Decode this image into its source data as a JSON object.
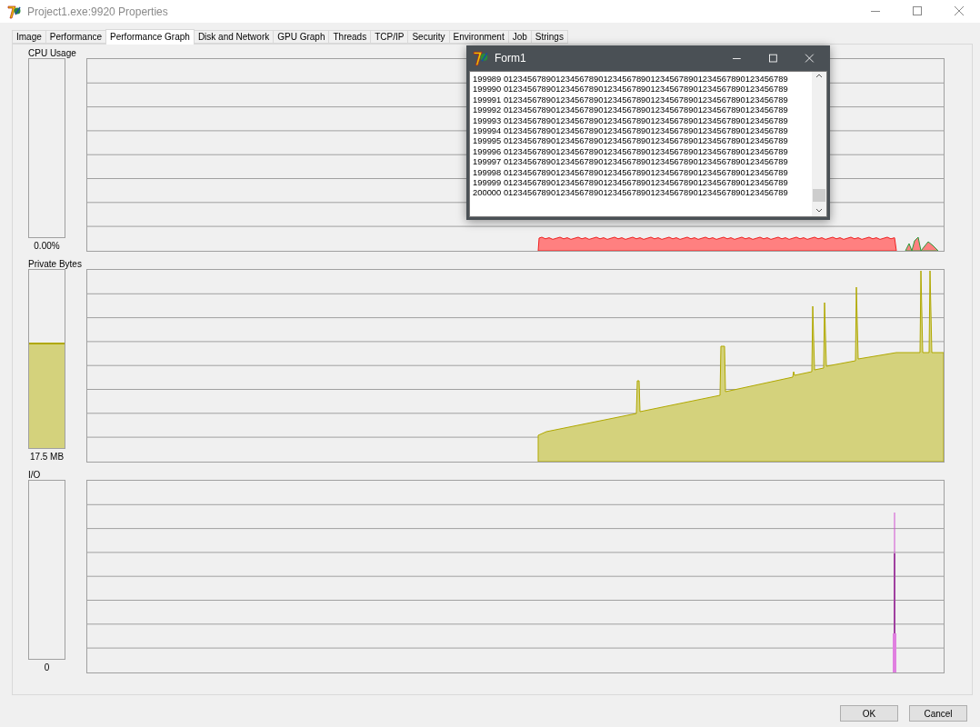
{
  "window": {
    "title": "Project1.exe:9920 Properties"
  },
  "tabs": [
    {
      "label": "Image",
      "selected": false
    },
    {
      "label": "Performance",
      "selected": false
    },
    {
      "label": "Performance Graph",
      "selected": true
    },
    {
      "label": "Disk and Network",
      "selected": false
    },
    {
      "label": "GPU Graph",
      "selected": false
    },
    {
      "label": "Threads",
      "selected": false
    },
    {
      "label": "TCP/IP",
      "selected": false
    },
    {
      "label": "Security",
      "selected": false
    },
    {
      "label": "Environment",
      "selected": false
    },
    {
      "label": "Job",
      "selected": false
    },
    {
      "label": "Strings",
      "selected": false
    }
  ],
  "panels": [
    {
      "kind": "cpu",
      "label": "CPU Usage",
      "reading": "0.00%",
      "level": 0
    },
    {
      "kind": "memory",
      "label": "Private Bytes",
      "reading": "17.5 MB",
      "level": 0.58
    },
    {
      "kind": "io",
      "label": "I/O",
      "reading": "0",
      "level": 0
    }
  ],
  "dialog": {
    "title": "Form1",
    "lines": [
      "199989 012345678901234567890123456789012345678901234567890123456789",
      "199990 012345678901234567890123456789012345678901234567890123456789",
      "199991 012345678901234567890123456789012345678901234567890123456789",
      "199992 012345678901234567890123456789012345678901234567890123456789",
      "199993 012345678901234567890123456789012345678901234567890123456789",
      "199994 012345678901234567890123456789012345678901234567890123456789",
      "199995 012345678901234567890123456789012345678901234567890123456789",
      "199996 012345678901234567890123456789012345678901234567890123456789",
      "199997 012345678901234567890123456789012345678901234567890123456789",
      "199998 012345678901234567890123456789012345678901234567890123456789",
      "199999 012345678901234567890123456789012345678901234567890123456789",
      "200000 012345678901234567890123456789012345678901234567890123456789"
    ]
  },
  "buttons": [
    "OK",
    "Cancel"
  ]
}
